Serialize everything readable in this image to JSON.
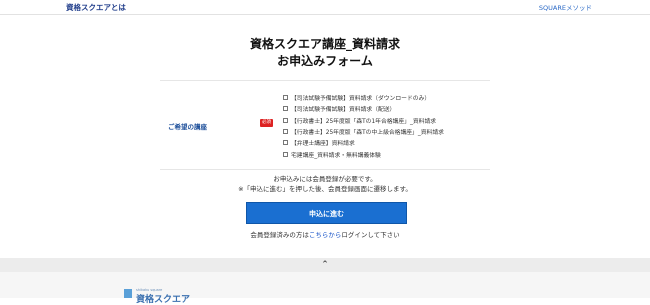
{
  "header": {
    "brand": "資格スクエアとは",
    "method_link": "SQUAREメソッド"
  },
  "title": {
    "line1": "資格スクエア講座_資料請求",
    "line2": "お申込みフォーム"
  },
  "form": {
    "label": "ご希望の講座",
    "required": "必須",
    "options": [
      "【司法試験予備試験】資料請求（ダウンロードのみ）",
      "【司法試験予備試験】資料請求（配送）",
      "【行政書士】25年度版「森Tの1年合格講座」_資料請求",
      "【行政書士】25年度版「森Tの中上級合格講座」_資料請求",
      "【弁理士講座】資料請求",
      "宅建講座_資料請求・無料講義体験"
    ]
  },
  "notes": {
    "line1": "お申込みには会員登録が必要です。",
    "line2": "※「申込に進む」を押した後、会員登録画面に遷移します。"
  },
  "submit_label": "申込に進む",
  "login": {
    "prefix": "会員登録済みの方は",
    "link": "こちらから",
    "suffix": "ログインして下さい"
  },
  "pagetop_icon": "chevron-up-icon",
  "footer": {
    "logo_sub": "shikaku square",
    "logo": "資格スクエア"
  },
  "colors": {
    "accent": "#1a6fd1",
    "required": "#d22222",
    "link": "#1a55c8"
  }
}
